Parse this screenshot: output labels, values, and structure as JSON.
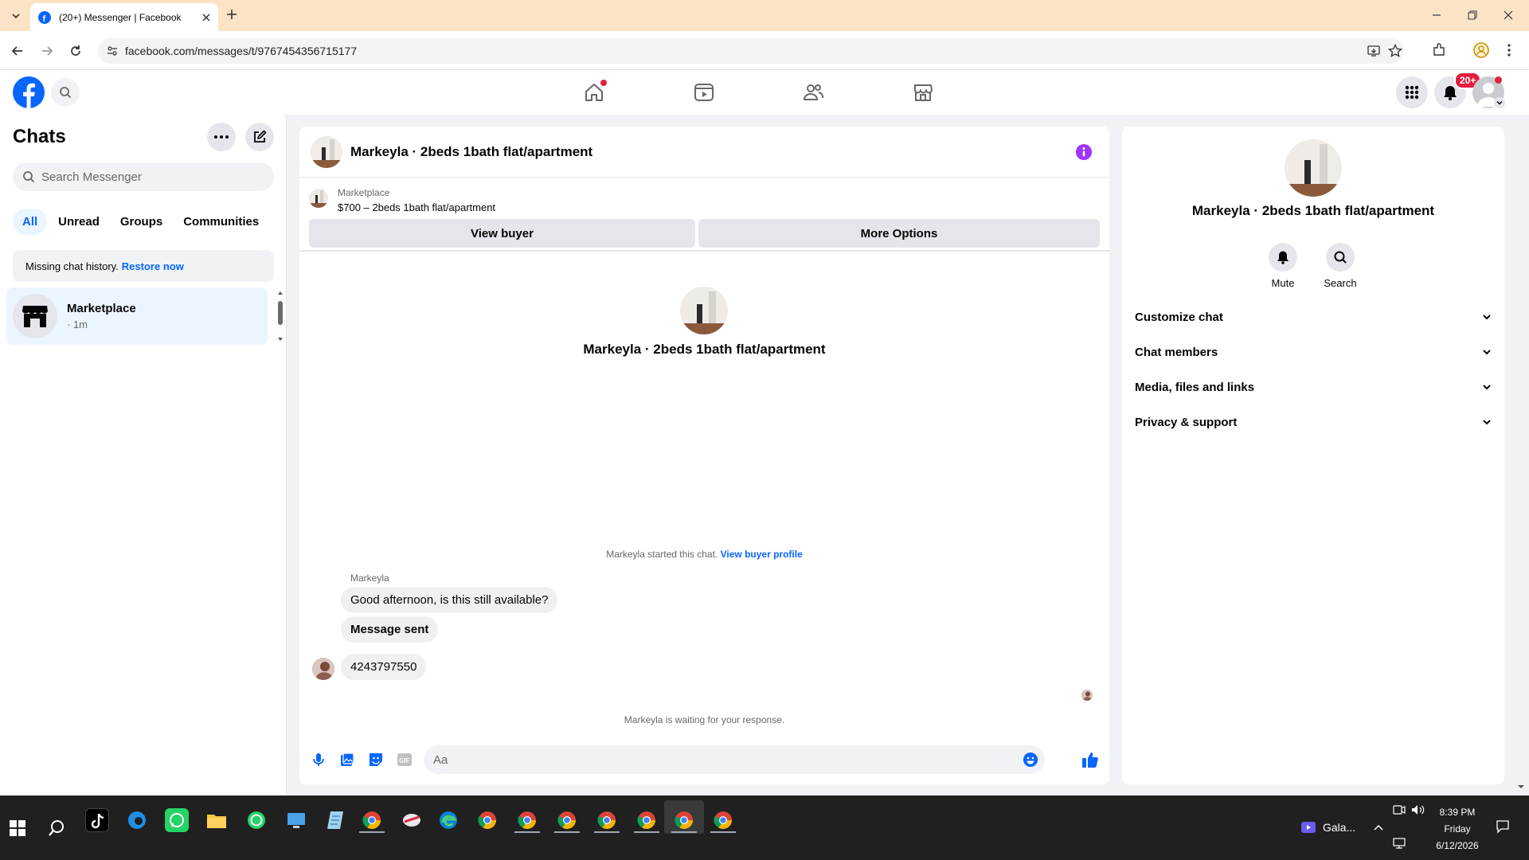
{
  "browser": {
    "tab_title": "(20+) Messenger | Facebook",
    "url": "facebook.com/messages/t/9767454356715177"
  },
  "header": {
    "notifications_badge": "20+"
  },
  "sidebar": {
    "title": "Chats",
    "search_placeholder": "Search Messenger",
    "filters": [
      "All",
      "Unread",
      "Groups",
      "Communities"
    ],
    "missing_history": "Missing chat history.",
    "restore_link": "Restore now",
    "chat_item": {
      "name": "Marketplace",
      "time": "· 1m"
    }
  },
  "chat": {
    "title": "Markeyla · 2beds 1bath flat/apartment",
    "listing_source": "Marketplace",
    "listing_title": "$700 – 2beds 1bath flat/apartment",
    "view_buyer_label": "View buyer",
    "more_options_label": "More Options",
    "intro_name": "Markeyla · 2beds 1bath flat/apartment",
    "started_text": "Markeyla started this chat.",
    "view_buyer_profile": "View buyer profile",
    "sender_name": "Markeyla",
    "messages": [
      "Good afternoon, is this still available?",
      "Message sent",
      "4243797550"
    ],
    "waiting_text": "Markeyla is waiting for your response.",
    "composer_placeholder": "Aa"
  },
  "info_panel": {
    "name": "Markeyla · 2beds 1bath flat/apartment",
    "mute_label": "Mute",
    "search_label": "Search",
    "sections": [
      "Customize chat",
      "Chat members",
      "Media, files and links",
      "Privacy & support"
    ]
  },
  "taskbar": {
    "app_label": "Gala...",
    "time": "8:39 PM",
    "day": "Friday",
    "date": "6/12/2026"
  },
  "colors": {
    "accent": "#0866ff",
    "messenger_purple": "#a033ff",
    "notification_red": "#e41e3f",
    "tab_bar": "#fde3c6"
  }
}
